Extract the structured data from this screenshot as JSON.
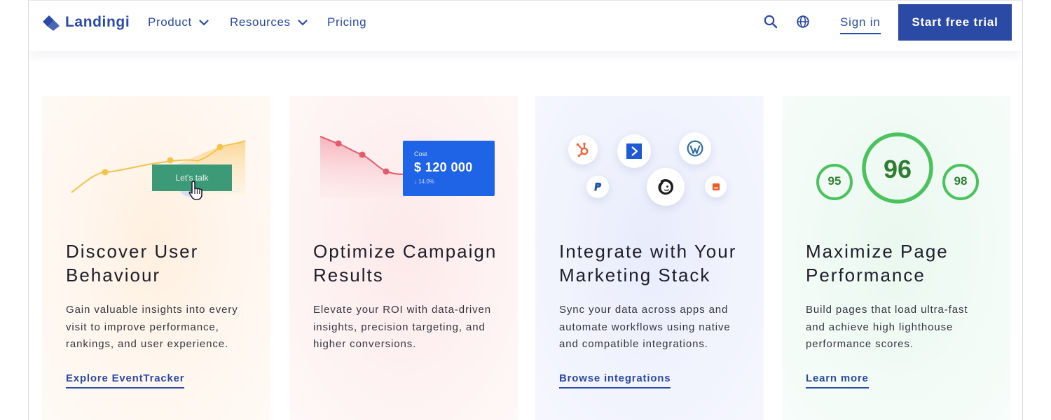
{
  "brand": {
    "name": "Landingi",
    "color": "#2b4aa5"
  },
  "nav": {
    "items": [
      {
        "label": "Product",
        "has_dropdown": true
      },
      {
        "label": "Resources",
        "has_dropdown": true
      },
      {
        "label": "Pricing",
        "has_dropdown": false
      }
    ],
    "icons": [
      "search-icon",
      "globe-icon"
    ],
    "signin_label": "Sign in",
    "cta_label": "Start free trial"
  },
  "cards": [
    {
      "title_line1": "Discover User",
      "title_line2": "Behaviour",
      "desc_line1": "Gain valuable insights into every",
      "desc_line2": "visit to improve performance,",
      "desc_line3": "rankings, and user experience.",
      "link": "Explore EventTracker",
      "illustration": {
        "button_label": "Let's talk"
      }
    },
    {
      "title_line1": "Optimize Campaign",
      "title_line2": "Results",
      "desc_line1": "Elevate your ROI with data-driven",
      "desc_line2": "insights, precision targeting, and",
      "desc_line3": "higher conversions.",
      "link": "",
      "illustration": {
        "cost_label": "Cost",
        "cost_value": "$ 120 000",
        "cost_delta": "↓  14.0%"
      }
    },
    {
      "title_line1": "Integrate with Your",
      "title_line2": "Marketing Stack",
      "desc_line1": "Sync your data across apps and",
      "desc_line2": "automate workflows using native",
      "desc_line3": "and compatible integrations.",
      "link": "Browse integrations",
      "illustration": {
        "icons": [
          "hubspot-icon",
          "activecampaign-icon",
          "wordpress-icon",
          "paypal-icon",
          "mailchimp-icon",
          "app-icon"
        ]
      }
    },
    {
      "title_line1": "Maximize Page",
      "title_line2": "Performance",
      "desc_line1": "Build pages that load ultra-fast",
      "desc_line2": "and achieve high lighthouse",
      "desc_line3": "performance scores.",
      "link": "Learn more",
      "illustration": {
        "scores": [
          "95",
          "96",
          "98"
        ],
        "score_color": "#4cc25e"
      }
    }
  ]
}
